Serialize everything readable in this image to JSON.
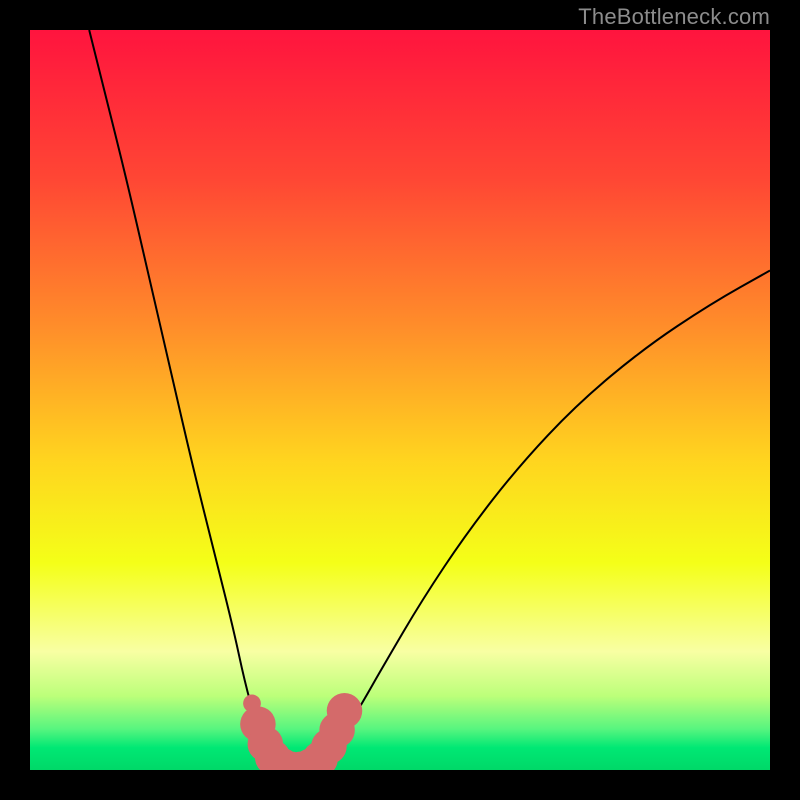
{
  "watermark": "TheBottleneck.com",
  "chart_data": {
    "type": "line",
    "title": "",
    "xlabel": "",
    "ylabel": "",
    "xlim": [
      0,
      100
    ],
    "ylim": [
      0,
      100
    ],
    "grid": false,
    "legend": false,
    "background_gradient_stops": [
      {
        "offset": 0.0,
        "color": "#ff143e"
      },
      {
        "offset": 0.2,
        "color": "#ff4634"
      },
      {
        "offset": 0.4,
        "color": "#ff8d2a"
      },
      {
        "offset": 0.58,
        "color": "#ffd41f"
      },
      {
        "offset": 0.72,
        "color": "#f4ff18"
      },
      {
        "offset": 0.84,
        "color": "#f8ffa3"
      },
      {
        "offset": 0.9,
        "color": "#bcff7a"
      },
      {
        "offset": 0.945,
        "color": "#56f57f"
      },
      {
        "offset": 0.97,
        "color": "#00e874"
      },
      {
        "offset": 1.0,
        "color": "#00d868"
      }
    ],
    "series": [
      {
        "name": "bottleneck-curve",
        "stroke": "#000000",
        "stroke_width": 2,
        "points": [
          {
            "x": 8.0,
            "y": 100.0
          },
          {
            "x": 10.0,
            "y": 92.0
          },
          {
            "x": 13.0,
            "y": 80.0
          },
          {
            "x": 16.0,
            "y": 67.0
          },
          {
            "x": 19.0,
            "y": 54.0
          },
          {
            "x": 22.0,
            "y": 41.0
          },
          {
            "x": 25.0,
            "y": 29.0
          },
          {
            "x": 27.5,
            "y": 19.0
          },
          {
            "x": 29.0,
            "y": 12.0
          },
          {
            "x": 30.5,
            "y": 6.5
          },
          {
            "x": 32.0,
            "y": 2.8
          },
          {
            "x": 33.5,
            "y": 0.8
          },
          {
            "x": 35.0,
            "y": 0.0
          },
          {
            "x": 37.0,
            "y": 0.0
          },
          {
            "x": 39.0,
            "y": 0.8
          },
          {
            "x": 41.0,
            "y": 2.8
          },
          {
            "x": 44.0,
            "y": 7.5
          },
          {
            "x": 48.0,
            "y": 14.5
          },
          {
            "x": 53.0,
            "y": 23.0
          },
          {
            "x": 59.0,
            "y": 32.0
          },
          {
            "x": 66.0,
            "y": 41.0
          },
          {
            "x": 74.0,
            "y": 49.5
          },
          {
            "x": 83.0,
            "y": 57.0
          },
          {
            "x": 92.0,
            "y": 63.0
          },
          {
            "x": 100.0,
            "y": 67.5
          }
        ]
      }
    ],
    "marker_series": {
      "name": "highlight-region",
      "color": "#d46a6a",
      "points": [
        {
          "x": 30.0,
          "y": 9.0,
          "r": 1.2
        },
        {
          "x": 30.8,
          "y": 6.2,
          "r": 2.4
        },
        {
          "x": 31.8,
          "y": 3.5,
          "r": 2.4
        },
        {
          "x": 32.8,
          "y": 1.7,
          "r": 2.4
        },
        {
          "x": 34.0,
          "y": 0.6,
          "r": 2.4
        },
        {
          "x": 35.3,
          "y": 0.1,
          "r": 2.4
        },
        {
          "x": 36.6,
          "y": 0.1,
          "r": 2.4
        },
        {
          "x": 37.9,
          "y": 0.5,
          "r": 2.4
        },
        {
          "x": 39.2,
          "y": 1.5,
          "r": 2.4
        },
        {
          "x": 40.4,
          "y": 3.2,
          "r": 2.4
        },
        {
          "x": 41.5,
          "y": 5.4,
          "r": 2.4
        },
        {
          "x": 42.5,
          "y": 8.0,
          "r": 2.4
        }
      ]
    }
  }
}
